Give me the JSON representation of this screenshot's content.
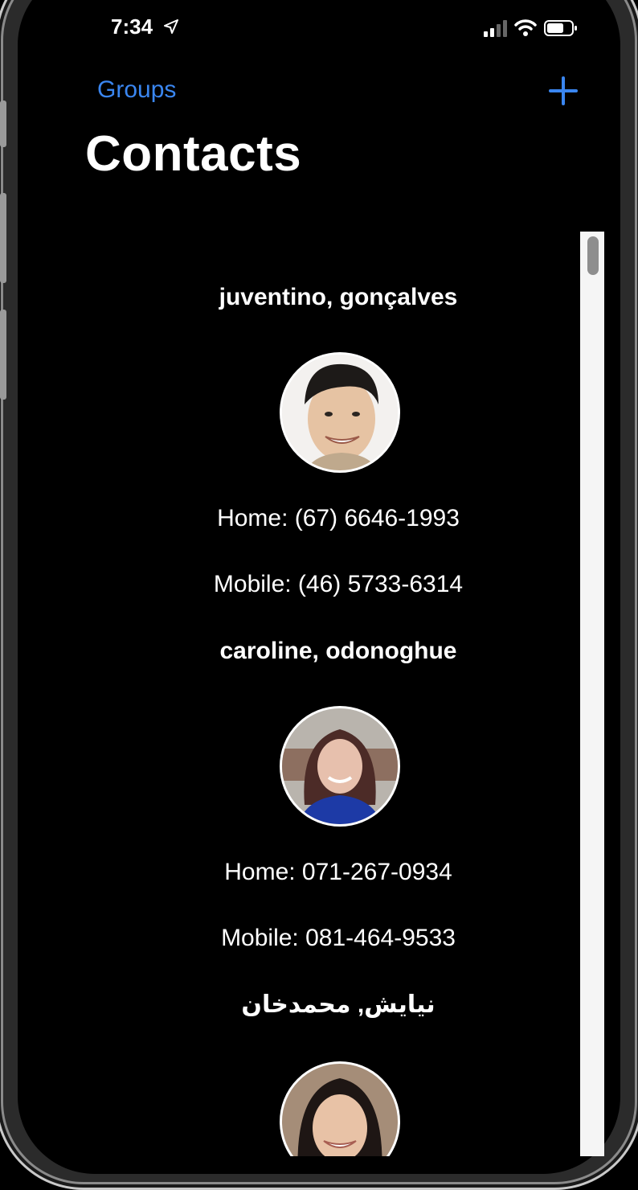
{
  "status_bar": {
    "time": "7:34"
  },
  "nav": {
    "back_label": "Groups",
    "title": "Contacts"
  },
  "contacts": [
    {
      "name": "juventino, gonçalves",
      "home": "Home: (67) 6646-1993",
      "mobile": "Mobile: (46) 5733-6314"
    },
    {
      "name": "caroline, odonoghue",
      "home": "Home: 071-267-0934",
      "mobile": "Mobile: 081-464-9533"
    },
    {
      "name": "نيايش, محمدخان"
    }
  ],
  "colors": {
    "accent": "#3a86f0",
    "background": "#000000",
    "text": "#ffffff"
  },
  "icons": [
    "location-arrow-icon",
    "signal-icon",
    "wifi-icon",
    "battery-icon",
    "plus-icon"
  ]
}
